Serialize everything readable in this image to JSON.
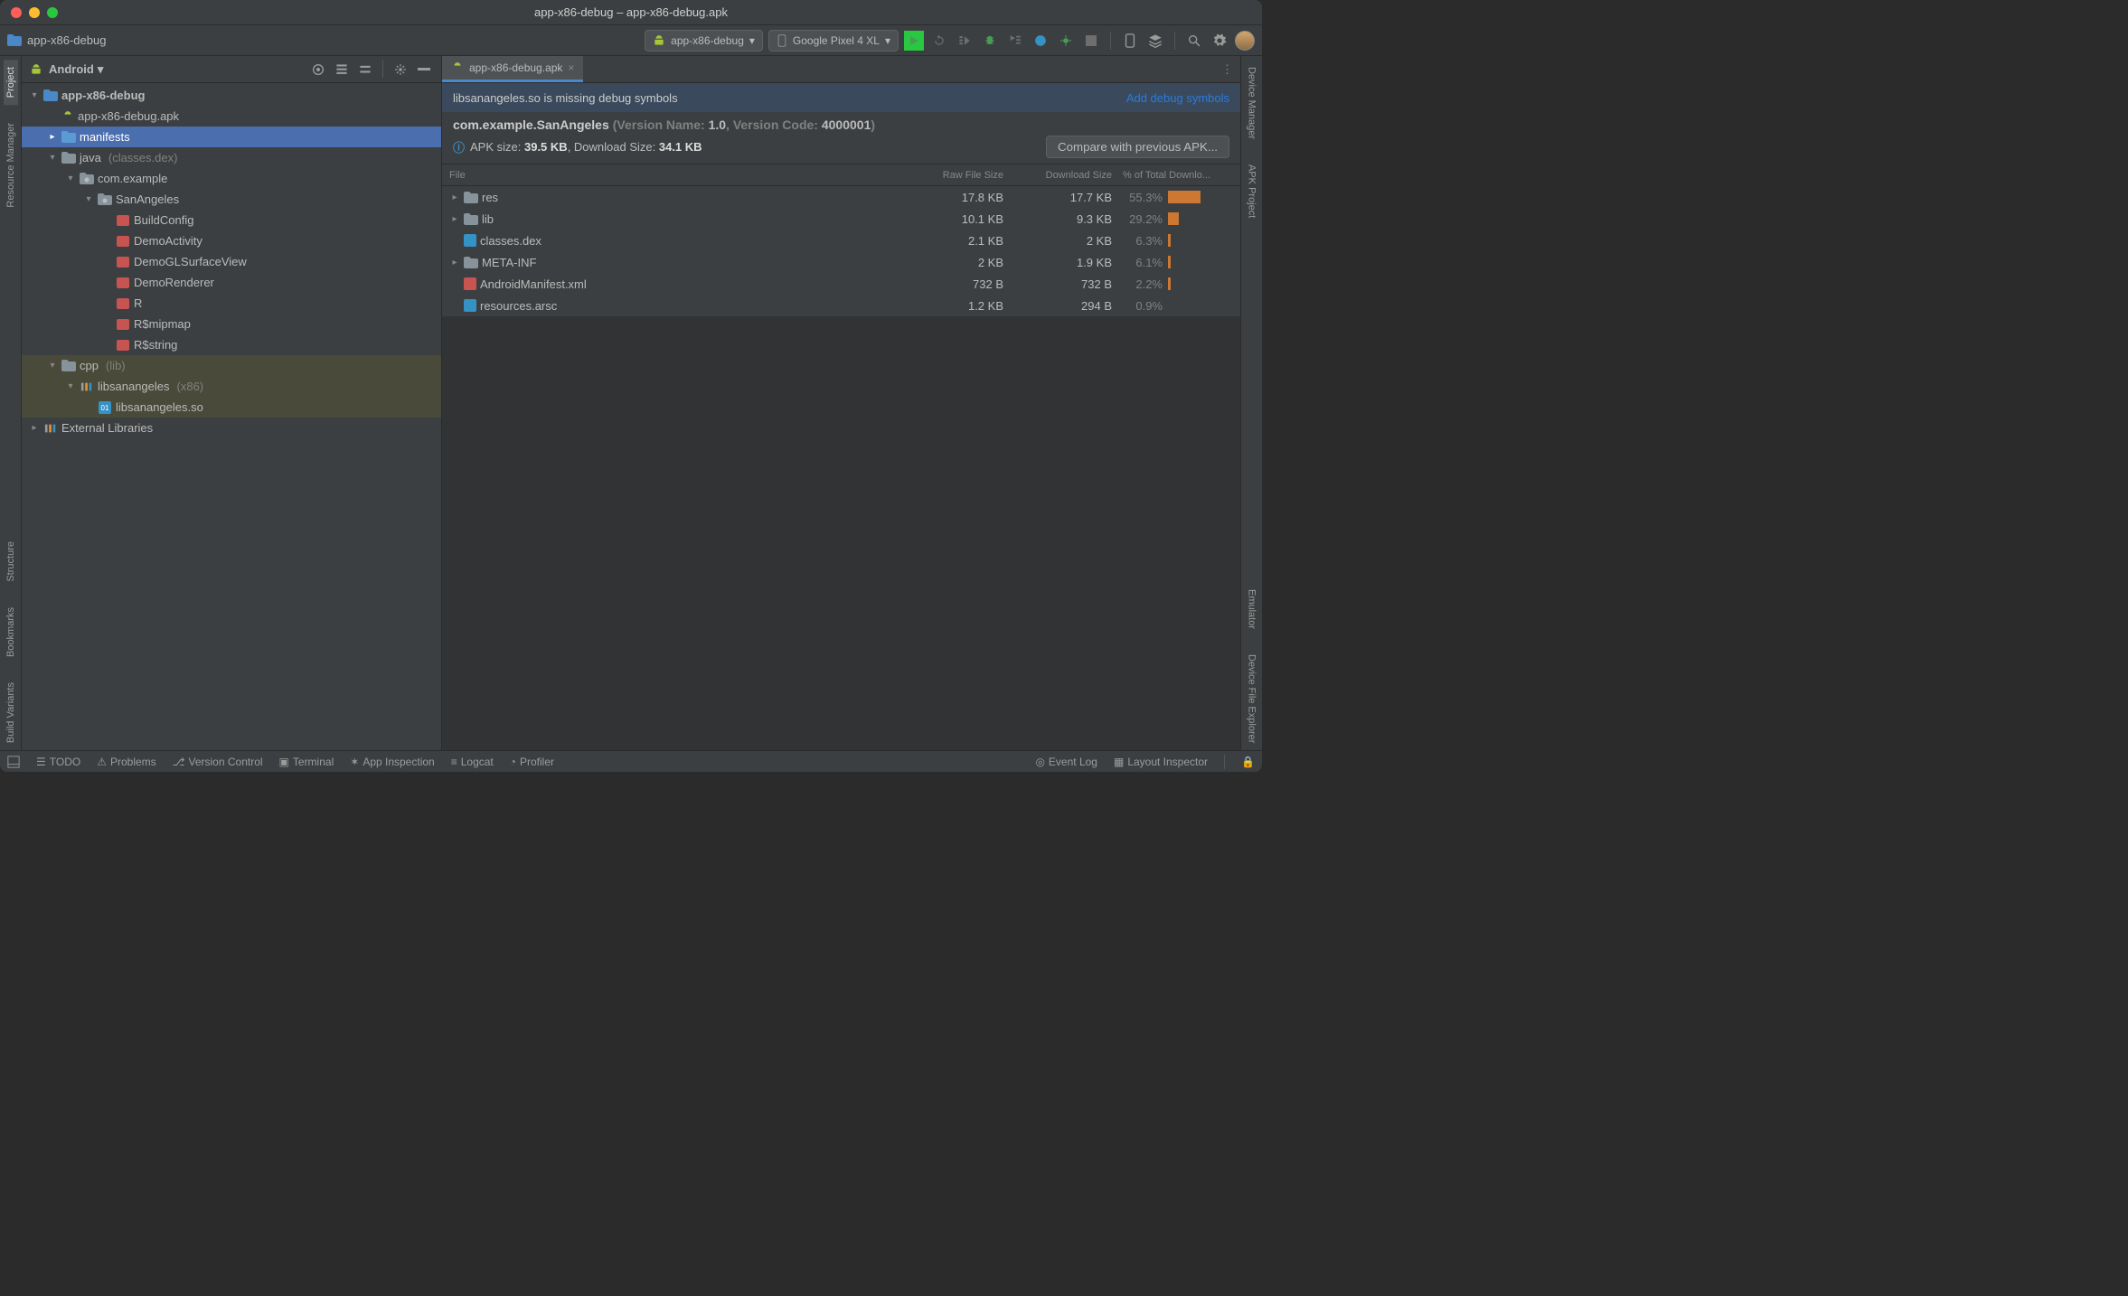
{
  "window_title": "app-x86-debug – app-x86-debug.apk",
  "breadcrumb": "app-x86-debug",
  "run_config": "app-x86-debug",
  "device": "Google Pixel 4 XL",
  "left_tools": [
    "Project",
    "Resource Manager",
    "Structure",
    "Bookmarks",
    "Build Variants"
  ],
  "right_tools": [
    "Device Manager",
    "APK Project",
    "Emulator",
    "Device File Explorer"
  ],
  "panel_mode": "Android",
  "tree": {
    "root": "app-x86-debug",
    "apk": "app-x86-debug.apk",
    "manifests": "manifests",
    "java": "java",
    "java_note": "(classes.dex)",
    "pkg1": "com.example",
    "pkg2": "SanAngeles",
    "classes": [
      "BuildConfig",
      "DemoActivity",
      "DemoGLSurfaceView",
      "DemoRenderer",
      "R",
      "R$mipmap",
      "R$string"
    ],
    "cpp": "cpp",
    "cpp_note": "(lib)",
    "libdir": "libsanangeles",
    "libdir_note": "(x86)",
    "libfile": "libsanangeles.so",
    "extlib": "External Libraries"
  },
  "tab": "app-x86-debug.apk",
  "warn_msg": "libsanangeles.so is missing debug symbols",
  "warn_link": "Add debug symbols",
  "pkg_name": "com.example.SanAngeles",
  "pkg_meta_prefix": " (Version Name: ",
  "pkg_version_name": "1.0",
  "pkg_meta_mid": ", Version Code: ",
  "pkg_version_code": "4000001",
  "pkg_meta_suffix": ")",
  "apk_size_label": "APK size: ",
  "apk_size": "39.5 KB",
  "dl_size_label": ", Download Size: ",
  "dl_size": "34.1 KB",
  "compare_btn": "Compare with previous APK...",
  "an_cols": {
    "file": "File",
    "raw": "Raw File Size",
    "dl": "Download Size",
    "pct": "% of Total Downlo..."
  },
  "analyzer_rows": [
    {
      "name": "res",
      "raw": "17.8 KB",
      "dl": "17.7 KB",
      "pct": "55.3%",
      "bar": 36,
      "exp": true,
      "icon": "folder"
    },
    {
      "name": "lib",
      "raw": "10.1 KB",
      "dl": "9.3 KB",
      "pct": "29.2%",
      "bar": 12,
      "exp": true,
      "icon": "folder"
    },
    {
      "name": "classes.dex",
      "raw": "2.1 KB",
      "dl": "2 KB",
      "pct": "6.3%",
      "bar": 3,
      "exp": false,
      "icon": "file"
    },
    {
      "name": "META-INF",
      "raw": "2 KB",
      "dl": "1.9 KB",
      "pct": "6.1%",
      "bar": 3,
      "exp": true,
      "icon": "folder"
    },
    {
      "name": "AndroidManifest.xml",
      "raw": "732 B",
      "dl": "732 B",
      "pct": "2.2%",
      "bar": 3,
      "exp": false,
      "icon": "xml"
    },
    {
      "name": "resources.arsc",
      "raw": "1.2 KB",
      "dl": "294 B",
      "pct": "0.9%",
      "bar": 0,
      "exp": false,
      "icon": "file"
    }
  ],
  "status_left": [
    "TODO",
    "Problems",
    "Version Control",
    "Terminal",
    "App Inspection",
    "Logcat",
    "Profiler"
  ],
  "status_right": [
    "Event Log",
    "Layout Inspector"
  ]
}
